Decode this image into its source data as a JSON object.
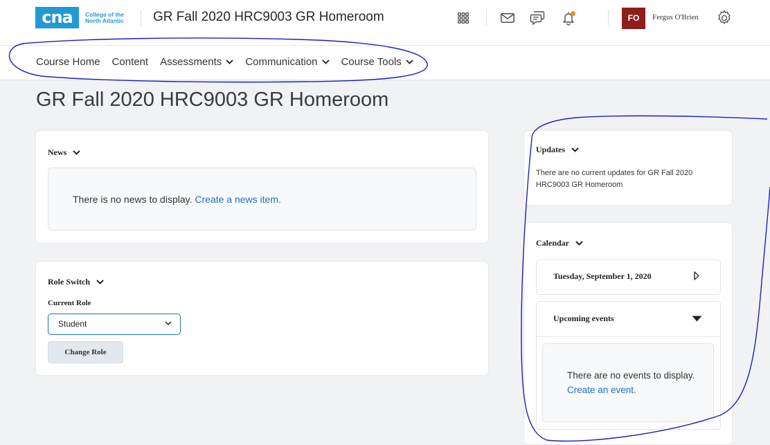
{
  "header": {
    "logo_text": "cna",
    "logo_subtitle_line1": "College of the",
    "logo_subtitle_line2": "North Atlantic",
    "course_title": "GR Fall 2020 HRC9003 GR Homeroom",
    "user_initials": "FO",
    "user_name": "Fergus O'Brien",
    "avatar_color": "#8e1d1d",
    "brand_color": "#1f9ad6"
  },
  "nav": {
    "items": [
      {
        "label": "Course Home",
        "has_dropdown": false
      },
      {
        "label": "Content",
        "has_dropdown": false
      },
      {
        "label": "Assessments",
        "has_dropdown": true
      },
      {
        "label": "Communication",
        "has_dropdown": true
      },
      {
        "label": "Course Tools",
        "has_dropdown": true
      }
    ]
  },
  "page": {
    "title": "GR Fall 2020 HRC9003 GR Homeroom"
  },
  "news": {
    "heading": "News",
    "empty_text": "There is no news to display. ",
    "create_link": "Create a news item."
  },
  "role_switch": {
    "heading": "Role Switch",
    "field_label": "Current Role",
    "selected_role": "Student",
    "button_label": "Change Role"
  },
  "updates": {
    "heading": "Updates",
    "text": "There are no current updates for GR Fall 2020 HRC9003 GR Homeroom"
  },
  "calendar": {
    "heading": "Calendar",
    "date": "Tuesday, September 1, 2020",
    "upcoming_heading": "Upcoming events",
    "empty_text": "There are no events to display. ",
    "create_link": "Create an event."
  },
  "icons": {
    "apps": "waffle-grid-icon",
    "mail": "envelope-icon",
    "chat": "chat-bubbles-icon",
    "notifications": "bell-icon",
    "settings": "gear-icon"
  },
  "colors": {
    "link": "#1e6fbf",
    "notification_dot": "#f08a24",
    "annotation_ink": "#1a1fbf"
  }
}
